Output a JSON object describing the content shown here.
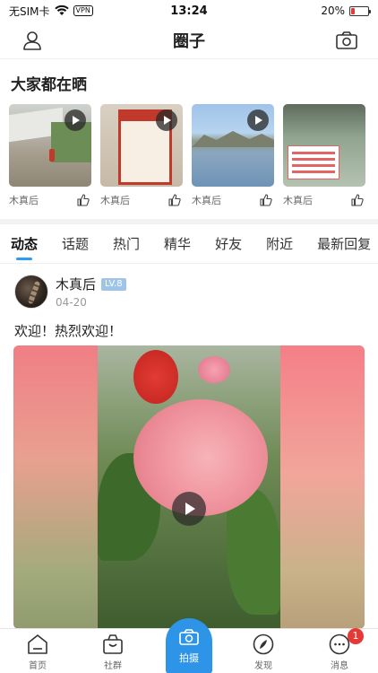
{
  "status_bar": {
    "carrier": "无SIM卡",
    "vpn": "VPN",
    "time": "13:24",
    "battery_percent": "20%",
    "battery_level": 0.2,
    "battery_color": "#e53935"
  },
  "header": {
    "title": "圈子",
    "left_icon": "user-icon",
    "right_icon": "camera-icon"
  },
  "share_section": {
    "title": "大家都在晒",
    "items": [
      {
        "author": "木真后"
      },
      {
        "author": "木真后"
      },
      {
        "author": "木真后"
      },
      {
        "author": "木真后"
      }
    ]
  },
  "tabs": [
    {
      "label": "动态",
      "active": true
    },
    {
      "label": "话题"
    },
    {
      "label": "热门"
    },
    {
      "label": "精华"
    },
    {
      "label": "好友"
    },
    {
      "label": "附近"
    },
    {
      "label": "最新回复"
    }
  ],
  "post": {
    "author": "木真后",
    "level": "LV.8",
    "date": "04-20",
    "text": "欢迎！热烈欢迎！"
  },
  "bottom_nav": {
    "items": [
      {
        "label": "首页",
        "icon": "home-icon"
      },
      {
        "label": "社群",
        "icon": "bag-icon"
      },
      {
        "label": "拍摄",
        "icon": "camera-icon"
      },
      {
        "label": "发现",
        "icon": "compass-icon"
      },
      {
        "label": "消息",
        "icon": "message-icon"
      }
    ],
    "messages_badge": "1",
    "accent_color": "#2e94e8"
  }
}
